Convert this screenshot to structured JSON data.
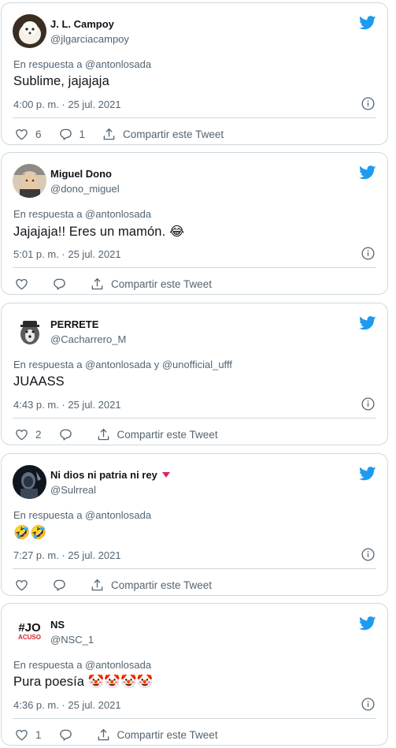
{
  "tweets": [
    {
      "name": "J. L. Campoy",
      "handle": "@jlgarciacampoy",
      "reply_label": "En respuesta a @antonlosada",
      "text": "Sublime, jajajaja",
      "time": "4:00 p. m. · 25 jul. 2021",
      "likes": "6",
      "replies": "1",
      "share_label": "Compartir este Tweet"
    },
    {
      "name": "Miguel Dono",
      "handle": "@dono_miguel",
      "reply_label": "En respuesta a @antonlosada",
      "text": "Jajajaja!! Eres un mamón. 😂",
      "time": "5:01 p. m. · 25 jul. 2021",
      "likes": "",
      "replies": "",
      "share_label": "Compartir este Tweet"
    },
    {
      "name": "PERRETE",
      "handle": "@Cacharrero_M",
      "reply_label": "En respuesta a @antonlosada y @unofficial_ufff",
      "text": "JUAASS",
      "time": "4:43 p. m. · 25 jul. 2021",
      "likes": "2",
      "replies": "",
      "share_label": "Compartir este Tweet"
    },
    {
      "name": "Ni dios ni patria ni rey",
      "handle": "@Sulrreal",
      "reply_label": "En respuesta a @antonlosada",
      "text": "🤣🤣",
      "time": "7:27 p. m. · 25 jul. 2021",
      "likes": "",
      "replies": "",
      "share_label": "Compartir este Tweet"
    },
    {
      "name": "NS",
      "handle": "@NSC_1",
      "reply_label": "En respuesta a @antonlosada",
      "text": "Pura poesía 🤡🤡🤡🤡",
      "time": "4:36 p. m. · 25 jul. 2021",
      "likes": "1",
      "replies": "",
      "share_label": "Compartir este Tweet",
      "avatar_text": "#JO ACUSO"
    }
  ],
  "colors": {
    "twitter_blue": "#1d9bf0",
    "muted": "#536471",
    "border": "#cfd9de",
    "badge": "#e0245e"
  },
  "icons": {
    "brand": "twitter-bird-icon",
    "info": "info-icon",
    "like": "heart-icon",
    "reply": "reply-bubble-icon",
    "share": "share-icon"
  }
}
